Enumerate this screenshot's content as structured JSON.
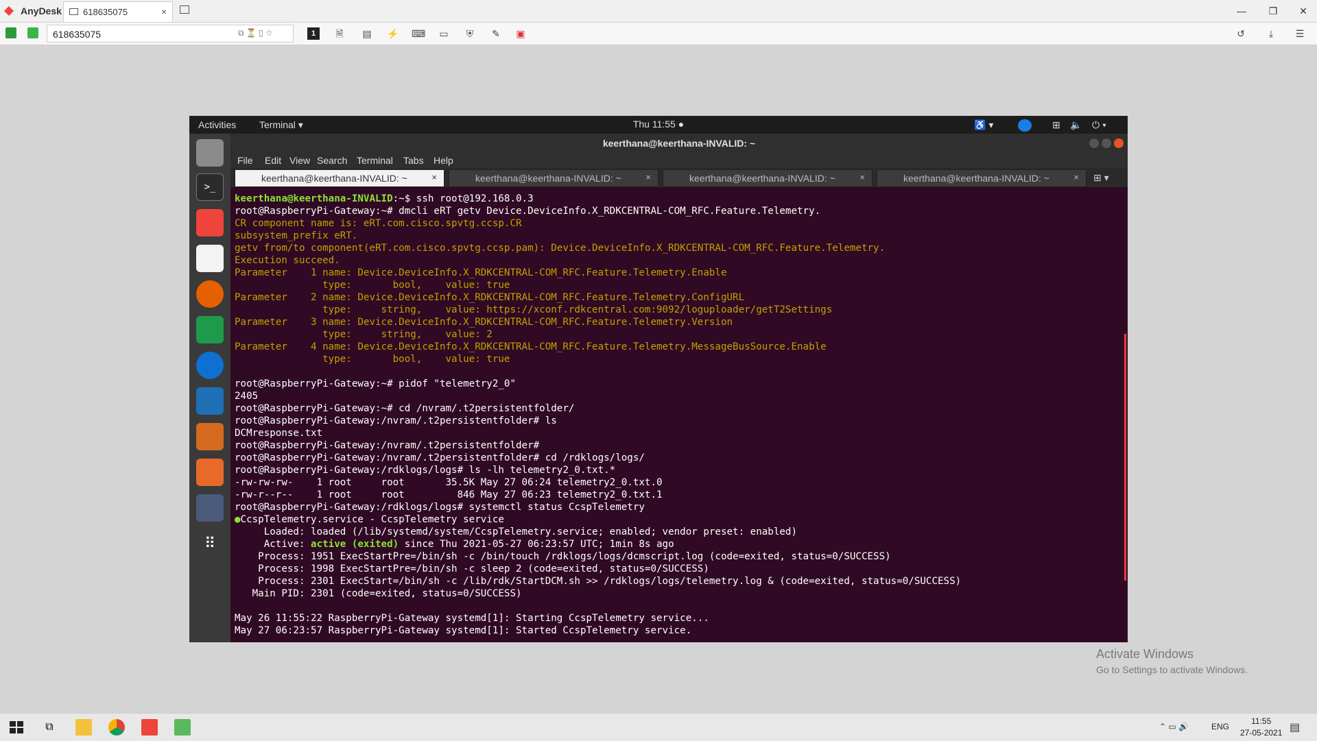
{
  "anydesk": {
    "app_name": "AnyDesk",
    "tab_label": "618635075",
    "address_value": "618635075"
  },
  "ubuntu": {
    "activities": "Activities",
    "app_menu": "Terminal ▾",
    "clock": "Thu 11:55 ●"
  },
  "terminal": {
    "title": "keerthana@keerthana-INVALID: ~",
    "menu": [
      "File",
      "Edit",
      "View",
      "Search",
      "Terminal",
      "Tabs",
      "Help"
    ],
    "tabs": [
      {
        "label": "keerthana@keerthana-INVALID: ~",
        "active": true
      },
      {
        "label": "keerthana@keerthana-INVALID: ~",
        "active": false
      },
      {
        "label": "keerthana@keerthana-INVALID: ~",
        "active": false
      },
      {
        "label": "keerthana@keerthana-INVALID: ~",
        "active": false
      }
    ],
    "lines": [
      {
        "parts": [
          {
            "t": "keerthana@keerthana-INVALID",
            "c": "ps1"
          },
          {
            "t": ":~$ ssh root@192.168.0.3",
            "c": ""
          }
        ]
      },
      {
        "parts": [
          {
            "t": "root@RaspberryPi-Gateway:~# dmcli eRT getv Device.DeviceInfo.X_RDKCENTRAL-COM_RFC.Feature.Telemetry.",
            "c": ""
          }
        ]
      },
      {
        "parts": [
          {
            "t": "CR component name is: eRT.com.cisco.spvtg.ccsp.CR",
            "c": "yel"
          }
        ]
      },
      {
        "parts": [
          {
            "t": "subsystem_prefix eRT.",
            "c": "yel"
          }
        ]
      },
      {
        "parts": [
          {
            "t": "getv from/to component(eRT.com.cisco.spvtg.ccsp.pam): Device.DeviceInfo.X_RDKCENTRAL-COM_RFC.Feature.Telemetry.",
            "c": "yel"
          }
        ]
      },
      {
        "parts": [
          {
            "t": "Execution succeed.",
            "c": "yel"
          }
        ]
      },
      {
        "parts": [
          {
            "t": "Parameter    1 name: Device.DeviceInfo.X_RDKCENTRAL-COM_RFC.Feature.Telemetry.Enable",
            "c": "yel"
          }
        ]
      },
      {
        "parts": [
          {
            "t": "               type:       bool,    value: true",
            "c": "yel"
          }
        ]
      },
      {
        "parts": [
          {
            "t": "Parameter    2 name: Device.DeviceInfo.X_RDKCENTRAL-COM_RFC.Feature.Telemetry.ConfigURL",
            "c": "yel"
          }
        ]
      },
      {
        "parts": [
          {
            "t": "               type:     string,    value: https://xconf.rdkcentral.com:9092/loguploader/getT2Settings",
            "c": "yel"
          }
        ]
      },
      {
        "parts": [
          {
            "t": "Parameter    3 name: Device.DeviceInfo.X_RDKCENTRAL-COM_RFC.Feature.Telemetry.Version",
            "c": "yel"
          }
        ]
      },
      {
        "parts": [
          {
            "t": "               type:     string,    value: 2",
            "c": "yel"
          }
        ]
      },
      {
        "parts": [
          {
            "t": "Parameter    4 name: Device.DeviceInfo.X_RDKCENTRAL-COM_RFC.Feature.Telemetry.MessageBusSource.Enable",
            "c": "yel"
          }
        ]
      },
      {
        "parts": [
          {
            "t": "               type:       bool,    value: true",
            "c": "yel"
          }
        ]
      },
      {
        "parts": [
          {
            "t": "",
            "c": ""
          }
        ]
      },
      {
        "parts": [
          {
            "t": "root@RaspberryPi-Gateway:~# pidof \"telemetry2_0\"",
            "c": ""
          }
        ]
      },
      {
        "parts": [
          {
            "t": "2405",
            "c": ""
          }
        ]
      },
      {
        "parts": [
          {
            "t": "root@RaspberryPi-Gateway:~# cd /nvram/.t2persistentfolder/",
            "c": ""
          }
        ]
      },
      {
        "parts": [
          {
            "t": "root@RaspberryPi-Gateway:/nvram/.t2persistentfolder# ls",
            "c": ""
          }
        ]
      },
      {
        "parts": [
          {
            "t": "DCMresponse.txt",
            "c": ""
          }
        ]
      },
      {
        "parts": [
          {
            "t": "root@RaspberryPi-Gateway:/nvram/.t2persistentfolder#",
            "c": ""
          }
        ]
      },
      {
        "parts": [
          {
            "t": "root@RaspberryPi-Gateway:/nvram/.t2persistentfolder# cd /rdklogs/logs/",
            "c": ""
          }
        ]
      },
      {
        "parts": [
          {
            "t": "root@RaspberryPi-Gateway:/rdklogs/logs# ls -lh telemetry2_0.txt.*",
            "c": ""
          }
        ]
      },
      {
        "parts": [
          {
            "t": "-rw-rw-rw-    1 root     root       35.5K May 27 06:24 telemetry2_0.txt.0",
            "c": ""
          }
        ]
      },
      {
        "parts": [
          {
            "t": "-rw-r--r--    1 root     root         846 May 27 06:23 telemetry2_0.txt.1",
            "c": ""
          }
        ]
      },
      {
        "parts": [
          {
            "t": "root@RaspberryPi-Gateway:/rdklogs/logs# systemctl status CcspTelemetry",
            "c": ""
          }
        ]
      },
      {
        "parts": [
          {
            "t": "●",
            "c": "gr"
          },
          {
            "t": "CcspTelemetry.service - CcspTelemetry service",
            "c": ""
          }
        ]
      },
      {
        "parts": [
          {
            "t": "     Loaded: loaded (/lib/systemd/system/CcspTelemetry.service; enabled; vendor preset: enabled)",
            "c": ""
          }
        ]
      },
      {
        "parts": [
          {
            "t": "     Active: ",
            "c": ""
          },
          {
            "t": "active (exited)",
            "c": "gr"
          },
          {
            "t": " since Thu 2021-05-27 06:23:57 UTC; 1min 8s ago",
            "c": ""
          }
        ]
      },
      {
        "parts": [
          {
            "t": "    Process: 1951 ExecStartPre=/bin/sh -c /bin/touch /rdklogs/logs/dcmscript.log (code=exited, status=0/SUCCESS)",
            "c": ""
          }
        ]
      },
      {
        "parts": [
          {
            "t": "    Process: 1998 ExecStartPre=/bin/sh -c sleep 2 (code=exited, status=0/SUCCESS)",
            "c": ""
          }
        ]
      },
      {
        "parts": [
          {
            "t": "    Process: 2301 ExecStart=/bin/sh -c /lib/rdk/StartDCM.sh >> /rdklogs/logs/telemetry.log & (code=exited, status=0/SUCCESS)",
            "c": ""
          }
        ]
      },
      {
        "parts": [
          {
            "t": "   Main PID: 2301 (code=exited, status=0/SUCCESS)",
            "c": ""
          }
        ]
      },
      {
        "parts": [
          {
            "t": "",
            "c": ""
          }
        ]
      },
      {
        "parts": [
          {
            "t": "May 26 11:55:22 RaspberryPi-Gateway systemd[1]: Starting CcspTelemetry service...",
            "c": ""
          }
        ]
      },
      {
        "parts": [
          {
            "t": "May 27 06:23:57 RaspberryPi-Gateway systemd[1]: Started CcspTelemetry service.",
            "c": ""
          }
        ]
      }
    ]
  },
  "watermark": {
    "line1": "Activate Windows",
    "line2": "Go to Settings to activate Windows."
  },
  "taskbar": {
    "lang": "ENG",
    "time": "11:55",
    "date": "27-05-2021"
  },
  "colors": {
    "terminal_bg": "#300a24",
    "prompt_green": "#8ae234",
    "output_yellow": "#c4a000",
    "anydesk_red": "#ef443b"
  }
}
